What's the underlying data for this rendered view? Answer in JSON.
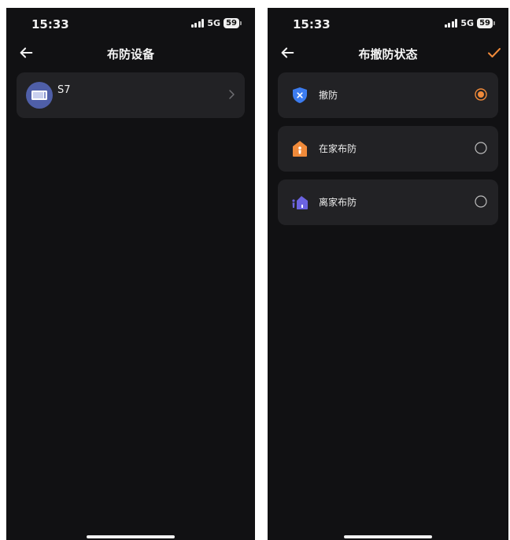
{
  "left_screen": {
    "status": {
      "time": "15:33",
      "network": "5G",
      "battery": "59"
    },
    "title": "布防设备",
    "device": {
      "name": "S7"
    }
  },
  "right_screen": {
    "status": {
      "time": "15:33",
      "network": "5G",
      "battery": "59"
    },
    "title": "布撤防状态",
    "options": [
      {
        "label": "撤防",
        "icon": "shield-x-icon",
        "selected": true
      },
      {
        "label": "在家布防",
        "icon": "home-person-icon",
        "selected": false
      },
      {
        "label": "离家布防",
        "icon": "away-home-icon",
        "selected": false
      }
    ]
  },
  "colors": {
    "accent": "#f08a3a",
    "background": "#111113",
    "card": "#222225"
  }
}
